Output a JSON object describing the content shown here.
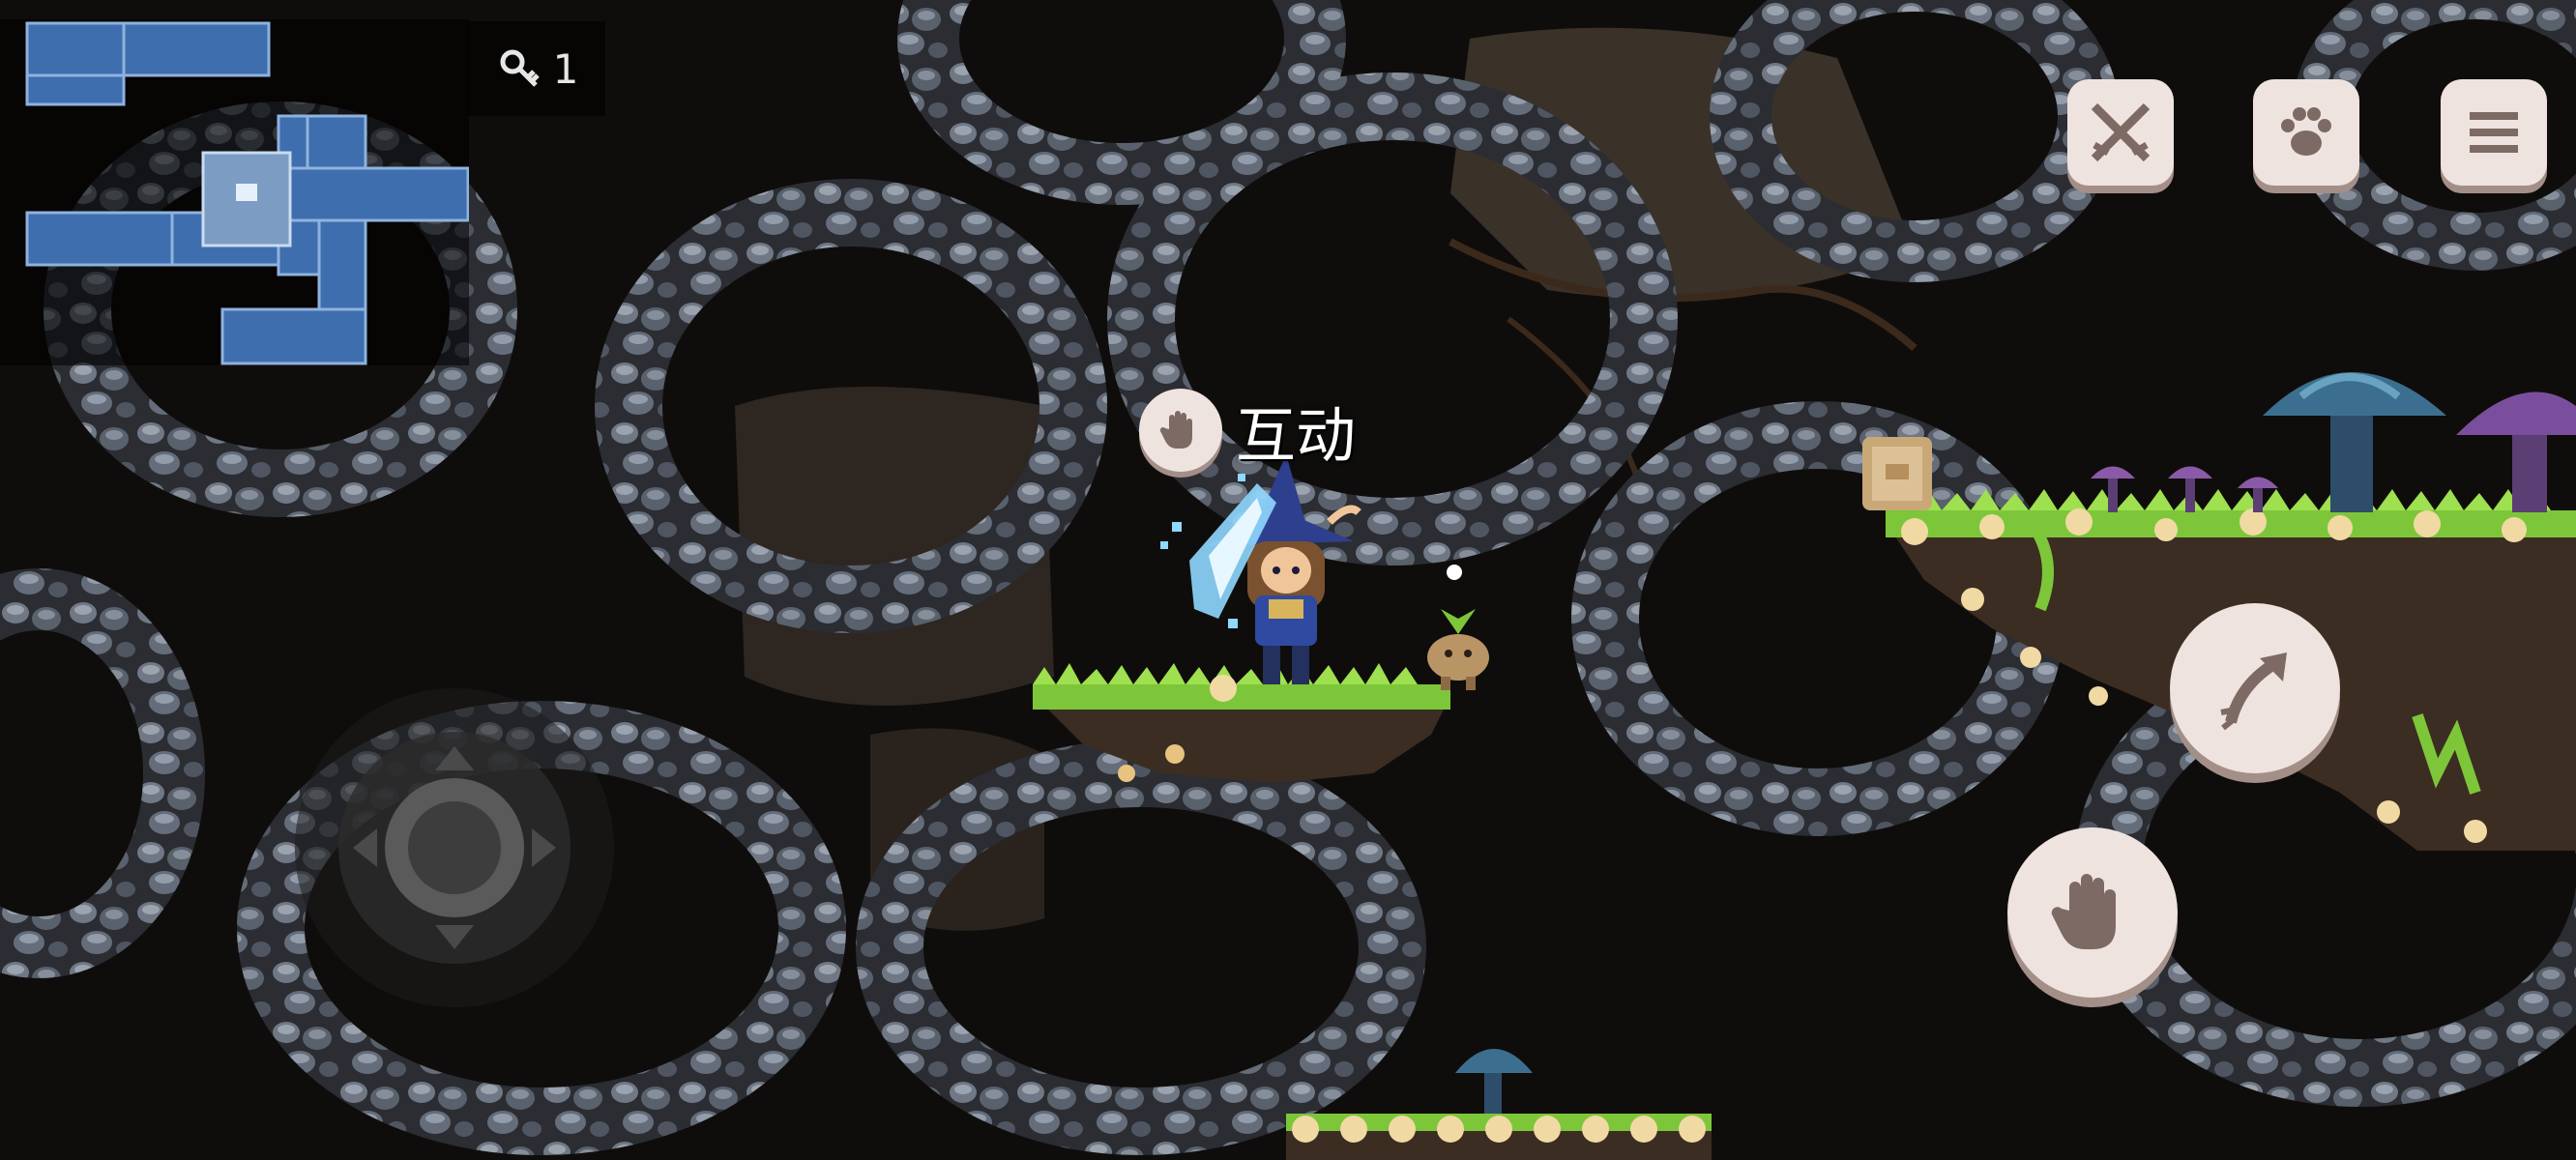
{
  "hud": {
    "key_count": "1",
    "key_icon": "key-icon"
  },
  "interact_prompt": {
    "label": "互动",
    "icon": "hand-icon"
  },
  "buttons": {
    "attack": "crossed-swords-icon",
    "pet": "paw-icon",
    "menu": "hamburger-menu-icon",
    "jump": "arrow-up-right-icon",
    "interact": "hand-icon"
  },
  "colors": {
    "minimap_room": "#3f6eae",
    "minimap_current": "#9cb9d6",
    "button_face": "#efe3df",
    "button_icon": "#7e6a64",
    "rock": "#5e6672",
    "grass": "#7dc63a",
    "cave_bg": "#2d251d"
  }
}
